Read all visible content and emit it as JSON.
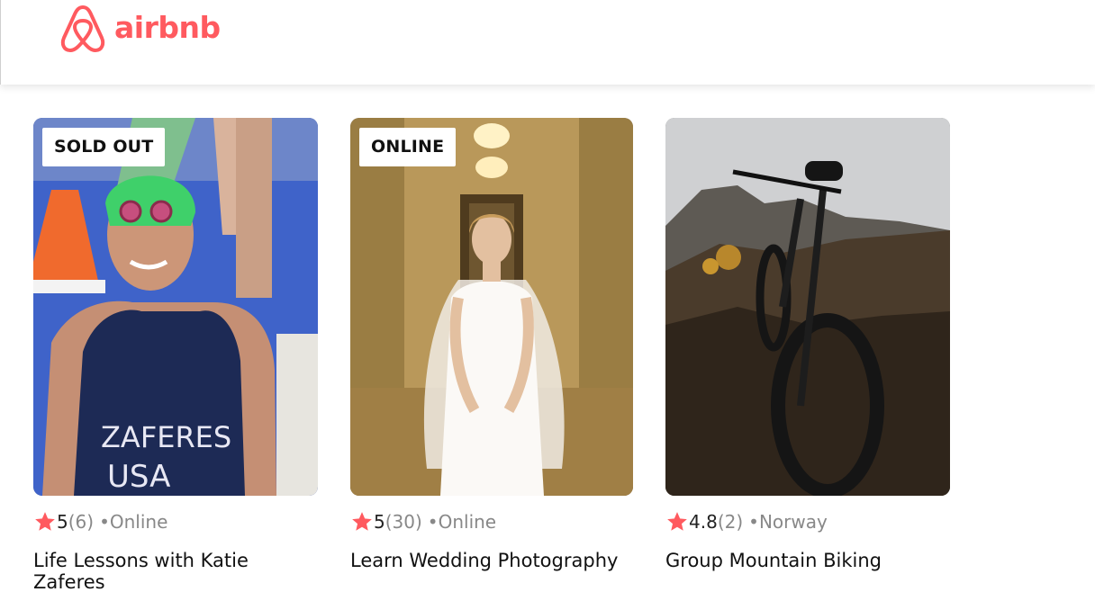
{
  "brand": {
    "name": "airbnb",
    "color": "#ff5a5f",
    "icon": "airbnb-belo-icon"
  },
  "colors": {
    "star": "#ff5a5f",
    "muted_text": "#888888",
    "text": "#111111"
  },
  "cards": [
    {
      "badge": "SOLD OUT",
      "image": "swimmer-in-triathlon-suit-photo",
      "rating": "5",
      "review_count": "(6)",
      "separator": "•",
      "location": "Online",
      "title": "Life Lessons with Katie Zaferes",
      "jersey_line1": "ZAFERES",
      "jersey_line2": "USA"
    },
    {
      "badge": "ONLINE",
      "image": "bride-in-wedding-dress-photo",
      "rating": "5",
      "review_count": "(30)",
      "separator": "•",
      "location": "Online",
      "title": "Learn Wedding Photography"
    },
    {
      "badge": "",
      "image": "mountain-bike-on-hillside-photo",
      "rating": "4.8",
      "review_count": "(2)",
      "separator": "•",
      "location": "Norway",
      "title": "Group Mountain Biking"
    }
  ]
}
